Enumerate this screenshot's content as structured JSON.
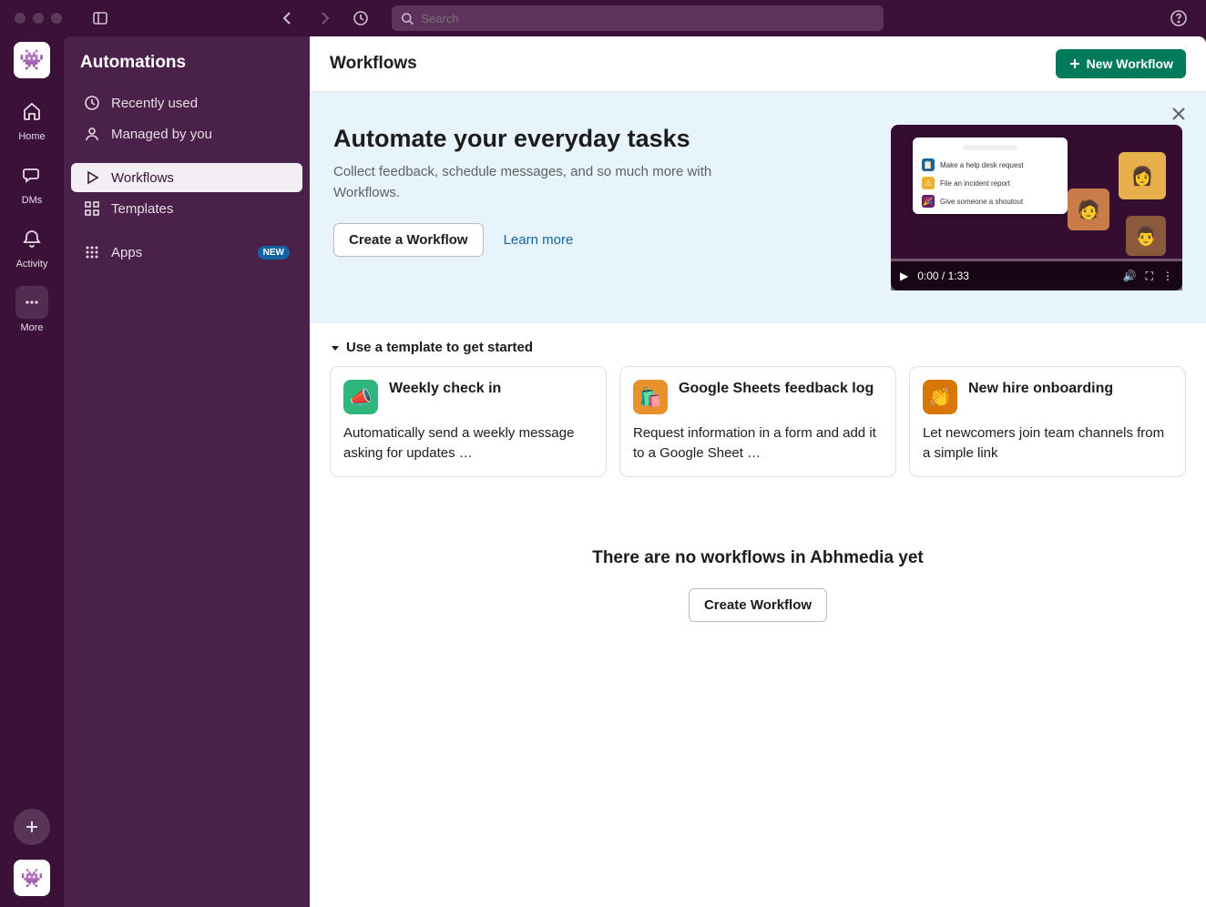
{
  "search": {
    "placeholder": "Search"
  },
  "rail": {
    "items": [
      {
        "label": "Home"
      },
      {
        "label": "DMs"
      },
      {
        "label": "Activity"
      },
      {
        "label": "More"
      }
    ]
  },
  "sidebar": {
    "title": "Automations",
    "items": [
      {
        "label": "Recently used"
      },
      {
        "label": "Managed by you"
      },
      {
        "label": "Workflows"
      },
      {
        "label": "Templates"
      },
      {
        "label": "Apps",
        "badge": "NEW"
      }
    ]
  },
  "main": {
    "title": "Workflows",
    "new_button": "New Workflow"
  },
  "hero": {
    "heading": "Automate your everyday tasks",
    "subtext": "Collect feedback, schedule messages, and so much more with Workflows.",
    "create_button": "Create a Workflow",
    "learn_more": "Learn more",
    "video": {
      "time": "0:00 / 1:33",
      "rows": [
        "Make a help desk request",
        "File an incident report",
        "Give someone a shoutout"
      ]
    }
  },
  "templates_section": {
    "header": "Use a template to get started",
    "cards": [
      {
        "title": "Weekly check in",
        "desc": "Automatically send a weekly message asking for updates …",
        "color": "#2eb67d",
        "emoji": "📣"
      },
      {
        "title": "Google Sheets feedback log",
        "desc": "Request information in a form and add it to a Google Sheet …",
        "color": "#e8912d",
        "emoji": "🛍️"
      },
      {
        "title": "New hire onboarding",
        "desc": "Let newcomers join team channels from a simple link",
        "color": "#d97706",
        "emoji": "👏"
      }
    ]
  },
  "empty_state": {
    "heading": "There are no workflows in Abhmedia yet",
    "button": "Create Workflow"
  }
}
